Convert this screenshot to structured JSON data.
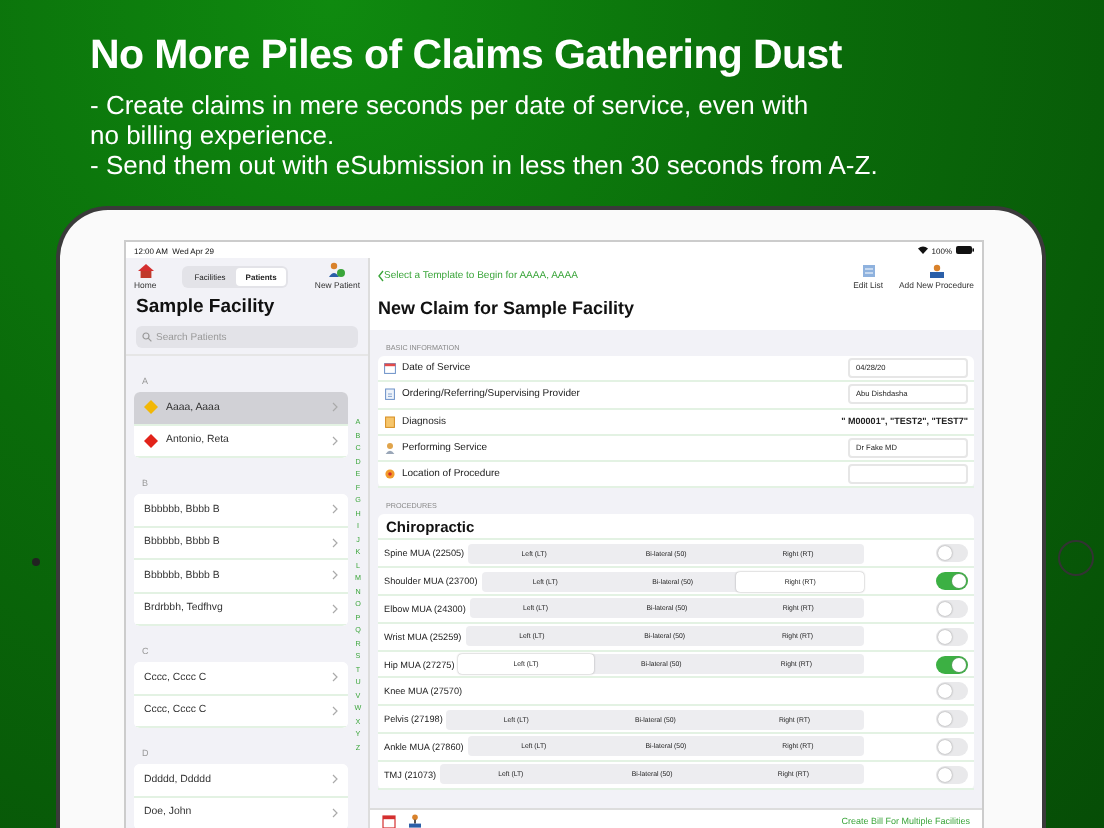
{
  "headline": "No More Piles of Claims Gathering Dust",
  "bullets": [
    "- Create claims in mere seconds per date of service, even with no billing experience.",
    "- Send them out with eSubmission in less then 30 seconds from A-Z."
  ],
  "status_bar": {
    "time": "12:00 AM",
    "date": "Wed Apr 29",
    "battery": "100%"
  },
  "sidebar": {
    "home_label": "Home",
    "segments": [
      {
        "label": "Facilities",
        "selected": false
      },
      {
        "label": "Patients",
        "selected": true
      }
    ],
    "new_patient_label": "New Patient",
    "title": "Sample Facility",
    "search": {
      "placeholder": "Search Patients"
    },
    "sections": [
      {
        "letter": "A",
        "patients": [
          {
            "name": "Aaaa, Aaaa",
            "selected": true,
            "color": "#f2b705"
          },
          {
            "name": "Antonio, Reta",
            "selected": false,
            "color": "#e2231a"
          }
        ]
      },
      {
        "letter": "B",
        "patients": [
          {
            "name": "Bbbbbb, Bbbb B",
            "selected": false
          },
          {
            "name": "Bbbbbb, Bbbb B",
            "selected": false
          },
          {
            "name": "Bbbbbb, Bbbb B",
            "selected": false
          },
          {
            "name": "Brdrbbh, Tedfhvg",
            "selected": false
          }
        ]
      },
      {
        "letter": "C",
        "patients": [
          {
            "name": "Cccc, Cccc C",
            "selected": false
          },
          {
            "name": "Cccc, Cccc C",
            "selected": false
          }
        ]
      },
      {
        "letter": "D",
        "patients": [
          {
            "name": "Ddddd, Ddddd",
            "selected": false
          },
          {
            "name": "Doe, John",
            "selected": false
          }
        ]
      }
    ],
    "index_letters": [
      "A",
      "B",
      "C",
      "D",
      "E",
      "F",
      "G",
      "H",
      "I",
      "J",
      "K",
      "L",
      "M",
      "N",
      "O",
      "P",
      "Q",
      "R",
      "S",
      "T",
      "U",
      "V",
      "W",
      "X",
      "Y",
      "Z"
    ]
  },
  "main": {
    "back_link": "Select a Template to Begin for AAAA, AAAA",
    "toolbar": [
      {
        "label": "Edit List"
      },
      {
        "label": "Add New Procedure"
      }
    ],
    "title": "New Claim for Sample Facility",
    "basic_heading": "BASIC INFORMATION",
    "basic_rows": [
      {
        "label": "Date of Service",
        "kind": "field",
        "value": "04/28/20"
      },
      {
        "label": "Ordering/Referring/Supervising Provider",
        "kind": "field",
        "value": "Abu Dishdasha"
      },
      {
        "label": "Diagnosis",
        "kind": "text",
        "value": "\" M00001\", \"TEST2\", \"TEST7\""
      },
      {
        "label": "Performing Service",
        "kind": "field",
        "value": "Dr Fake MD"
      },
      {
        "label": "Location of Procedure",
        "kind": "field"
      }
    ],
    "procedures_heading": "PROCEDURES",
    "category": "Chiropractic",
    "procedures": [
      {
        "name": "Spine MUA (22505)",
        "kind": "segmented",
        "on": false,
        "options": [
          {
            "label": "Left (LT)",
            "selected": false
          },
          {
            "label": "Bi-lateral (50)",
            "selected": false
          },
          {
            "label": "Right (RT)",
            "selected": false
          }
        ]
      },
      {
        "name": "Shoulder MUA (23700)",
        "kind": "segmented",
        "on": true,
        "options": [
          {
            "label": "Left (LT)",
            "selected": false
          },
          {
            "label": "Bi-lateral (50)",
            "selected": false
          },
          {
            "label": "Right (RT)",
            "selected": true
          }
        ]
      },
      {
        "name": "Elbow MUA (24300)",
        "kind": "segmented",
        "on": false,
        "options": [
          {
            "label": "Left (LT)",
            "selected": false
          },
          {
            "label": "Bi-lateral (50)",
            "selected": false
          },
          {
            "label": "Right (RT)",
            "selected": false
          }
        ]
      },
      {
        "name": "Wrist MUA (25259)",
        "kind": "segmented",
        "on": false,
        "options": [
          {
            "label": "Left (LT)",
            "selected": false
          },
          {
            "label": "Bi-lateral (50)",
            "selected": false
          },
          {
            "label": "Right (RT)",
            "selected": false
          }
        ]
      },
      {
        "name": "Hip MUA (27275)",
        "kind": "segmented",
        "on": true,
        "options": [
          {
            "label": "Left (LT)",
            "selected": true
          },
          {
            "label": "Bi-lateral (50)",
            "selected": false
          },
          {
            "label": "Right (RT)",
            "selected": false
          }
        ]
      },
      {
        "name": "Knee MUA (27570)",
        "kind": "plain",
        "on": false
      },
      {
        "name": "Pelvis (27198)",
        "kind": "segmented",
        "on": false,
        "options": [
          {
            "label": "Left (LT)",
            "selected": false
          },
          {
            "label": "Bi-lateral (50)",
            "selected": false
          },
          {
            "label": "Right (RT)",
            "selected": false
          }
        ]
      },
      {
        "name": "Ankle MUA (27860)",
        "kind": "segmented",
        "on": false,
        "options": [
          {
            "label": "Left (LT)",
            "selected": false
          },
          {
            "label": "Bi-lateral (50)",
            "selected": false
          },
          {
            "label": "Right (RT)",
            "selected": false
          }
        ]
      },
      {
        "name": "TMJ (21073)",
        "kind": "segmented",
        "on": false,
        "options": [
          {
            "label": "Left (LT)",
            "selected": false
          },
          {
            "label": "Bi-lateral (50)",
            "selected": false
          },
          {
            "label": "Right (RT)",
            "selected": false
          }
        ]
      }
    ],
    "create_bill": "Create Bill For Multiple Facilities"
  }
}
